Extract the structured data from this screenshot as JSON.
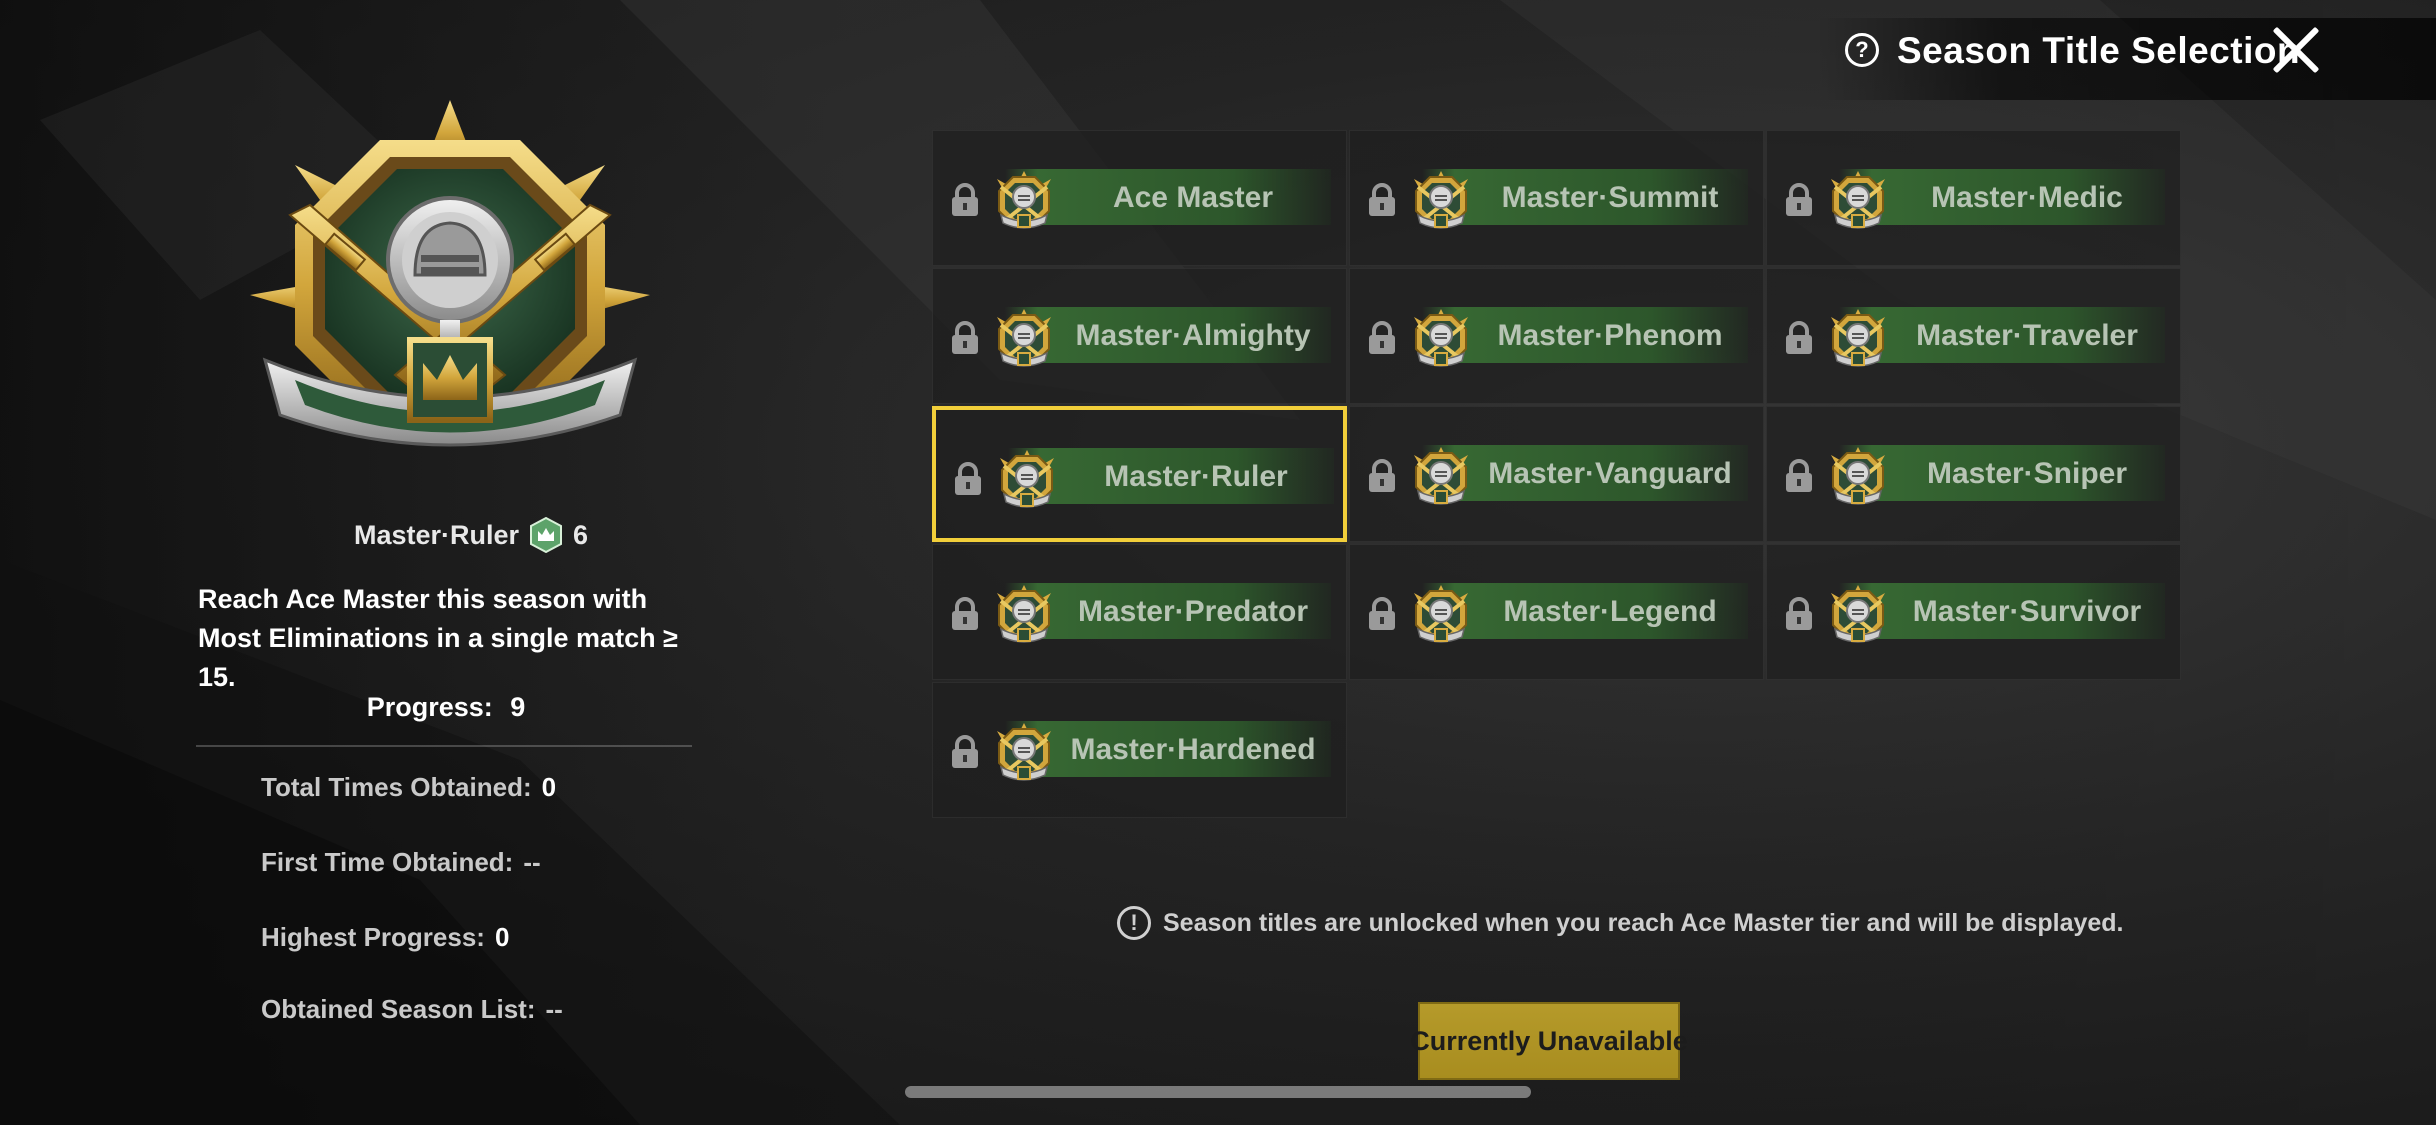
{
  "header": {
    "title": "Season Title Selection",
    "help_icon": "question-circle-icon",
    "close_icon": "close-x-icon"
  },
  "selected": {
    "name": "Master·Ruler",
    "tier_count": "6",
    "description": "Reach Ace Master this season with Most Eliminations in a single match  ≥  15.",
    "progress_label": "Progress:",
    "progress_value": "9"
  },
  "stats": {
    "total_times_label": "Total Times Obtained:",
    "total_times_value": "0",
    "first_time_label": "First Time Obtained:",
    "first_time_value": "--",
    "highest_progress_label": "Highest Progress:",
    "highest_progress_value": "0",
    "season_list_label": "Obtained Season List:",
    "season_list_value": "--"
  },
  "titles": [
    {
      "label": "Ace Master",
      "locked": true
    },
    {
      "label": "Master·Summit",
      "locked": true
    },
    {
      "label": "Master·Medic",
      "locked": true
    },
    {
      "label": "Master·Almighty",
      "locked": true
    },
    {
      "label": "Master·Phenom",
      "locked": true
    },
    {
      "label": "Master·Traveler",
      "locked": true
    },
    {
      "label": "Master·Ruler",
      "locked": true,
      "selected": true
    },
    {
      "label": "Master·Vanguard",
      "locked": true
    },
    {
      "label": "Master·Sniper",
      "locked": true
    },
    {
      "label": "Master·Predator",
      "locked": true
    },
    {
      "label": "Master·Legend",
      "locked": true
    },
    {
      "label": "Master·Survivor",
      "locked": true
    },
    {
      "label": "Master·Hardened",
      "locked": true
    }
  ],
  "notice": {
    "text": "Season titles are unlocked when you reach Ace Master tier and will be displayed.",
    "icon": "exclamation-circle-icon"
  },
  "action_button": {
    "label": "Currently Unavailable"
  },
  "colors": {
    "highlight": "#f2cf3a",
    "tile_band": "#386c34",
    "button": "#b59a2a"
  }
}
